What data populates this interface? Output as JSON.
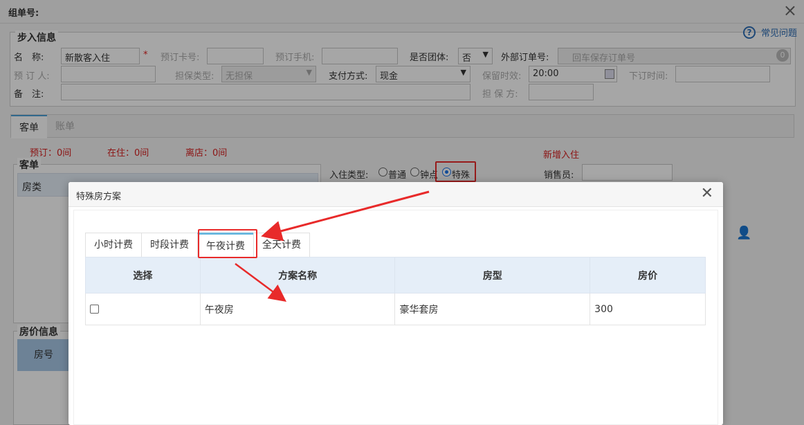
{
  "window": {
    "title": "组单号:",
    "close_icon": "×"
  },
  "help": {
    "label": "常见问题"
  },
  "step_info": {
    "legend": "步入信息",
    "name_label": "名　称:",
    "name_value": "新散客入住",
    "required_mark": "*",
    "card_label": "预订卡号:",
    "phone_label": "预订手机:",
    "group_label": "是否团体:",
    "group_value": "否",
    "ext_order_label": "外部订单号:",
    "ext_order_placeholder": "回车保存订单号",
    "ext_badge": "0",
    "booker_label": "预 订 人:",
    "guarantee_type_label": "担保类型:",
    "guarantee_type_value": "无担保",
    "pay_label": "支付方式:",
    "pay_value": "现金",
    "hold_label": "保留时效:",
    "hold_value": "20:00",
    "next_time_label": "下订时间:",
    "remark_label": "备　注:",
    "guarantor_label": "担 保 方:"
  },
  "tabs": [
    {
      "label": "客单"
    },
    {
      "label": "账单"
    }
  ],
  "stats": {
    "reserved": "预订：0间",
    "staying": "在住：0间",
    "left": "离店：0间",
    "new_checkin": "新增入住"
  },
  "guest": {
    "legend": "客单",
    "room_type_col": "房类",
    "checkin_type_label": "入住类型:",
    "options": [
      {
        "label": "普通"
      },
      {
        "label": "钟点"
      },
      {
        "label": "特殊"
      }
    ],
    "salesperson_label": "销售员:"
  },
  "room_price": {
    "legend": "房价信息",
    "room_no_col": "房号"
  },
  "modal": {
    "title": "特殊房方案",
    "tabs": [
      {
        "label": "小时计费"
      },
      {
        "label": "时段计费"
      },
      {
        "label": "午夜计费"
      },
      {
        "label": "全天计费"
      }
    ],
    "columns": [
      "选择",
      "方案名称",
      "房型",
      "房价"
    ],
    "rows": [
      {
        "name": "午夜房",
        "room_type": "豪华套房",
        "price": "300"
      }
    ]
  },
  "colors": {
    "annotation": "#e82a2a",
    "header_bg": "#e5eef8",
    "tab_accent": "#6bb8de",
    "link": "#2f6fb7"
  }
}
